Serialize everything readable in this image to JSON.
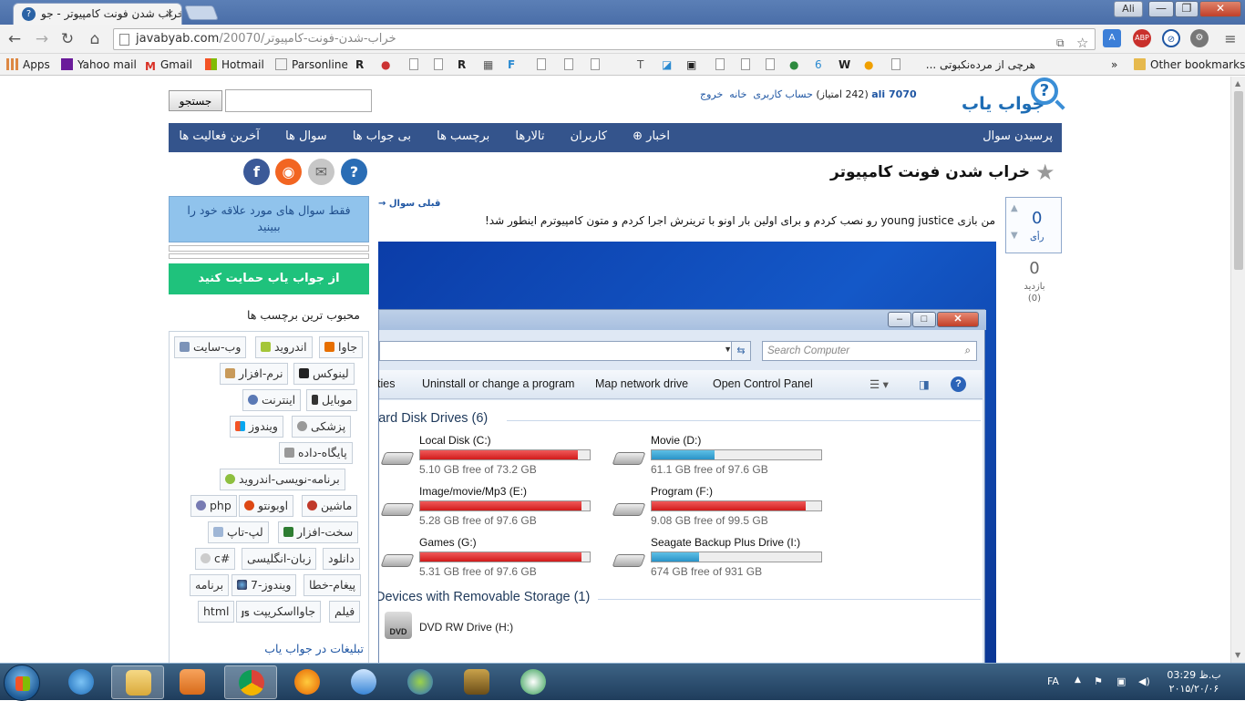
{
  "browser": {
    "tab_title": "خراب شدن فونت کامپیوتر - جو",
    "tab_close": "×",
    "user_badge": "Ali",
    "win_min": "—",
    "win_max": "❐",
    "win_close": "✕",
    "url_host": "javabyab.com",
    "url_path": "/20070/خراب-شدن-فونت-کامپیوتر",
    "extension_abp_label": "ABP"
  },
  "bookmarks": {
    "apps": "Apps",
    "yahoo": "Yahoo mail",
    "gmail": "Gmail",
    "hotmail": "Hotmail",
    "parsonline": "Parsonline",
    "persian_item": "هرچی از مرده‌نکبوتی ...",
    "more": "»",
    "other": "Other bookmarks"
  },
  "site": {
    "logo": "جواب یاب",
    "logo_mark": "?",
    "username": "ali 7070",
    "points": "(242 امتیاز)",
    "account": "حساب کاربری",
    "home": "خانه",
    "logout": "خروج",
    "search_button": "جستجو",
    "search_placeholder": ""
  },
  "nav": {
    "ask": "پرسیدن سوال",
    "items": [
      "اخبار ⊕",
      "کاربران",
      "تالارها",
      "برچسب ها",
      "بی جواب ها",
      "سوال ها",
      "آخرین فعالیت ها"
    ]
  },
  "question": {
    "title": "خراب شدن فونت کامپیوتر",
    "votes": "0",
    "votes_label": "رأی",
    "views": "0",
    "views_label": "بازدید",
    "views_extra": "(0)",
    "prev_link": "→ قبلی سوال",
    "body": "من بازی young justice رو نصب کردم و برای اولین بار اونو با ترینرش اجرا کردم و متون کامپیوترم اینطور شد!"
  },
  "screenshot": {
    "search_placeholder": "Search Computer",
    "cmd_properties": "ties",
    "cmd_uninstall": "Uninstall or change a program",
    "cmd_map": "Map network drive",
    "cmd_control": "Open Control Panel",
    "group_hdd": "lard Disk Drives (6)",
    "group_removable": "Devices with Removable Storage (1)",
    "dvd_name": "DVD RW Drive (H:)",
    "dvd_label": "DVD",
    "drives": [
      {
        "name": "Local Disk (C:)",
        "free": "5.10 GB free of 73.2 GB",
        "used_fraction": 0.93,
        "color": "red"
      },
      {
        "name": "Movie (D:)",
        "free": "61.1 GB free of 97.6 GB",
        "used_fraction": 0.37,
        "color": "blue"
      },
      {
        "name": "Image/movie/Mp3 (E:)",
        "free": "5.28 GB free of 97.6 GB",
        "used_fraction": 0.95,
        "color": "red"
      },
      {
        "name": "Program (F:)",
        "free": "9.08 GB free of 99.5 GB",
        "used_fraction": 0.91,
        "color": "red"
      },
      {
        "name": "Games (G:)",
        "free": "5.31 GB free of 97.6 GB",
        "used_fraction": 0.95,
        "color": "red"
      },
      {
        "name": "Seagate Backup Plus Drive (I:)",
        "free": "674 GB free of 931 GB",
        "used_fraction": 0.28,
        "color": "blue"
      }
    ]
  },
  "sidebar": {
    "fav_box": "فقط سوال های مورد علاقه خود را ببینید",
    "support": "از جواب یاب حمایت کنید",
    "popular_title": "محبوب ترین برچسب ها",
    "ads_title": "تبلیغات در جواب یاب",
    "tags": [
      "جاوا",
      "اندروید",
      "وب-سایت",
      "لینوکس",
      "نرم-افزار",
      "موبایل",
      "اینترنت",
      "پزشکی",
      "ویندوز",
      "پایگاه-داده",
      "برنامه-نویسی-اندروید",
      "ماشین",
      "اوبونتو",
      "php",
      "سخت-افزار",
      "لپ-تاپ",
      "دانلود",
      "زبان-انگلیسی",
      "c#",
      "پیغام-خطا",
      "ویندوز-7",
      "برنامه",
      "فیلم",
      "جاوااسکریپت",
      "html"
    ]
  },
  "taskbar": {
    "lang": "FA",
    "time": "03:29 ب.ظ",
    "date": "۲۰۱۵/۲۰/۰۶"
  },
  "colors": {
    "nav_bg": "#34548c",
    "link": "#1f56a3",
    "support_bg": "#1fc27c",
    "fav_bg": "#90c3ec"
  }
}
